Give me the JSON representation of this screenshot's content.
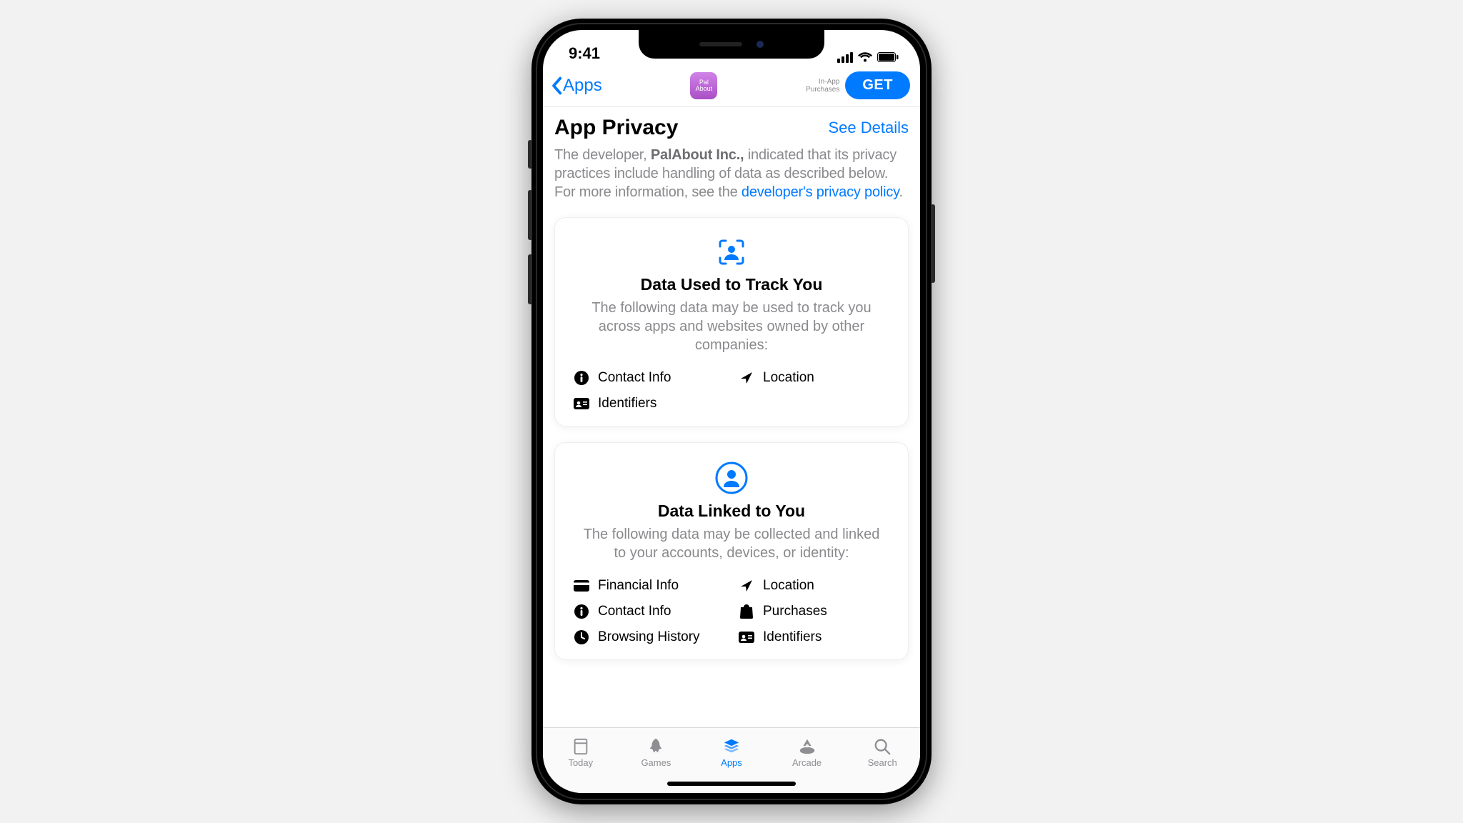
{
  "status": {
    "time": "9:41"
  },
  "nav": {
    "back_label": "Apps",
    "app_icon_text": "Pal\nAbout",
    "iap_line1": "In-App",
    "iap_line2": "Purchases",
    "get_label": "GET"
  },
  "header": {
    "title": "App Privacy",
    "see_details": "See Details",
    "desc_prefix": "The developer, ",
    "developer": "PalAbout Inc.,",
    "desc_mid": " indicated that its privacy practices include handling of data as described below. For more information, see the ",
    "policy_link": "developer's privacy policy",
    "desc_suffix": "."
  },
  "cards": {
    "track": {
      "title": "Data Used to Track You",
      "body": "The following data may be used to track you across apps and websites owned by other companies:",
      "items": {
        "contact": "Contact Info",
        "location": "Location",
        "identifiers": "Identifiers"
      }
    },
    "linked": {
      "title": "Data Linked to You",
      "body": "The following data may be collected and linked to your accounts, devices, or identity:",
      "items": {
        "financial": "Financial Info",
        "location": "Location",
        "contact": "Contact Info",
        "purchases": "Purchases",
        "browsing": "Browsing History",
        "identifiers": "Identifiers"
      }
    }
  },
  "tabs": {
    "today": "Today",
    "games": "Games",
    "apps": "Apps",
    "arcade": "Arcade",
    "search": "Search"
  }
}
